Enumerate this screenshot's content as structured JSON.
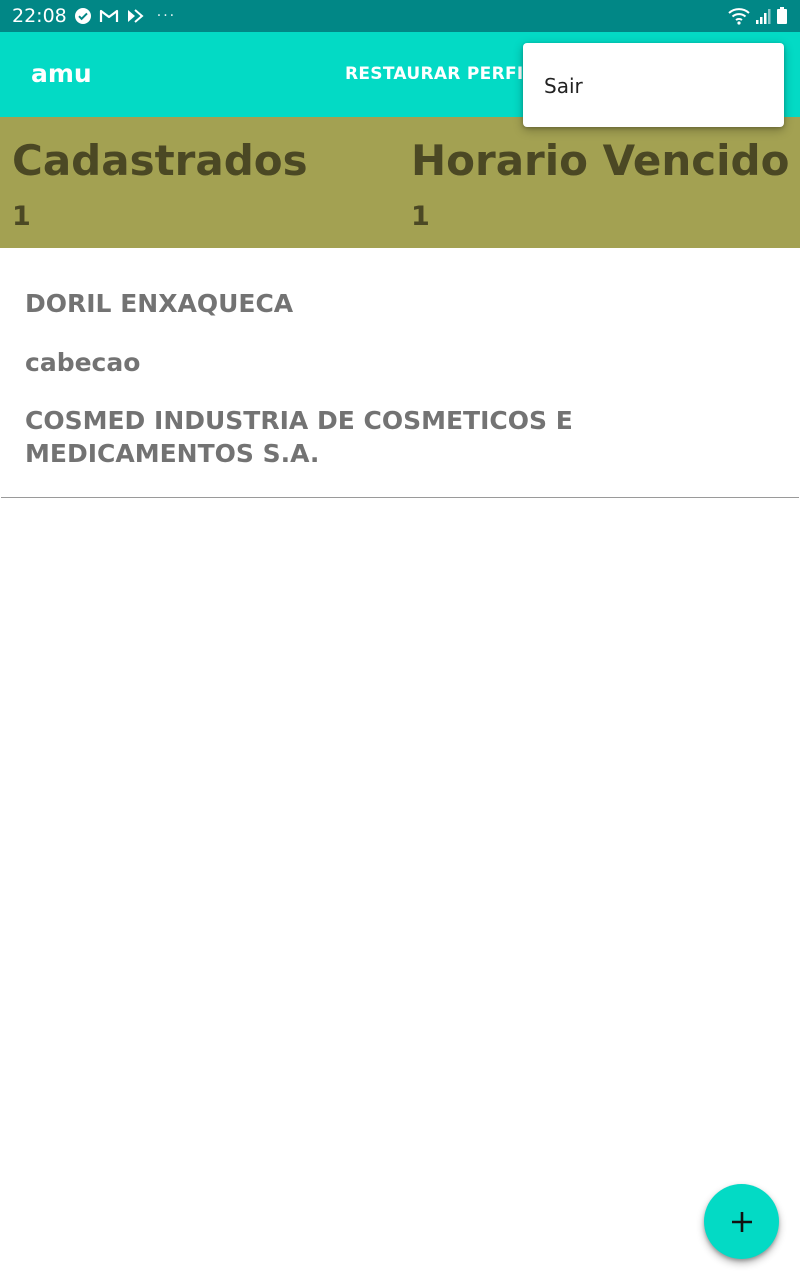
{
  "status_bar": {
    "time": "22:08",
    "notification_icons": [
      "check-circle-icon",
      "gmail-icon",
      "app-notification-icon"
    ],
    "more_indicator": "···",
    "right_icons": [
      "wifi-icon",
      "signal-icon",
      "battery-icon"
    ]
  },
  "app_bar": {
    "title": "amu",
    "action_label": "RESTAURAR PERFIL"
  },
  "overflow_menu": {
    "items": [
      {
        "label": "Sair"
      }
    ]
  },
  "stats": [
    {
      "label": "Cadastrados",
      "value": "1"
    },
    {
      "label": "Horario Vencido",
      "value": "1"
    }
  ],
  "list": {
    "items": [
      {
        "name": "DORIL ENXAQUECA",
        "description": "cabecao",
        "manufacturer": "COSMED INDUSTRIA DE COSMETICOS E MEDICAMENTOS S.A."
      }
    ]
  },
  "fab": {
    "icon": "plus-icon"
  },
  "colors": {
    "status_bar": "#018786",
    "app_bar": "#03DAC5",
    "stats_background": "#A3A152",
    "stats_text": "#4B4824",
    "item_text": "#737373",
    "fab": "#03DAC5"
  }
}
